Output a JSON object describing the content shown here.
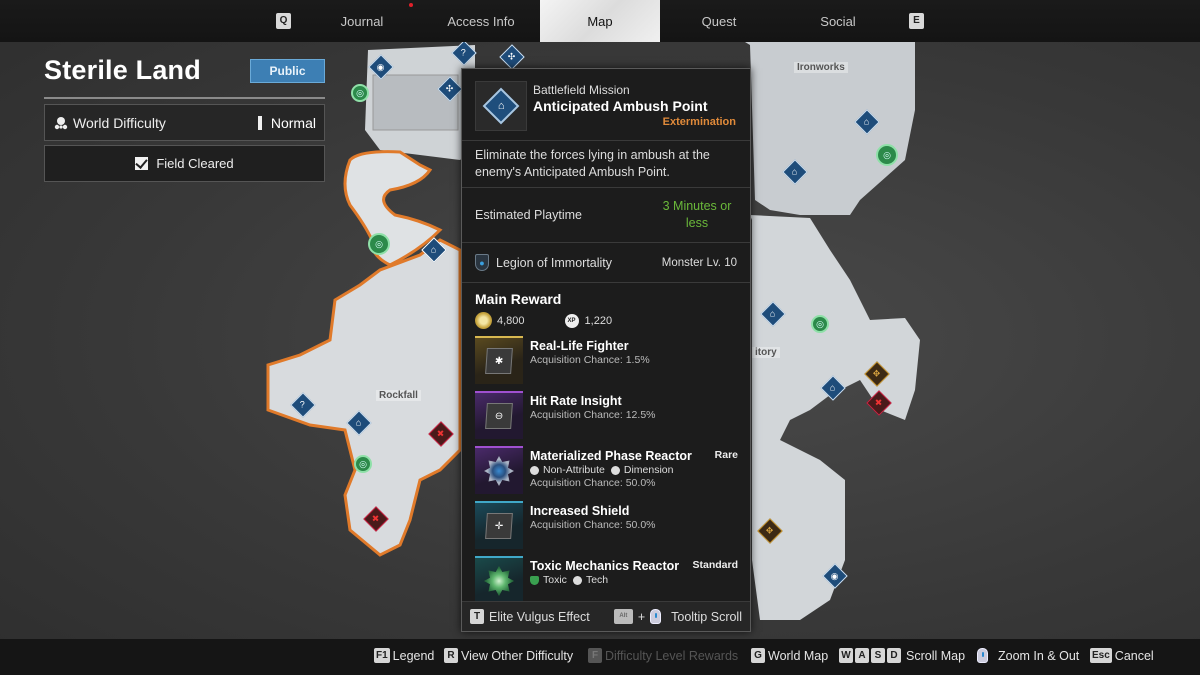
{
  "nav": {
    "prev_key": "Q",
    "next_key": "E",
    "tabs": [
      {
        "label": "Journal",
        "active": false,
        "notification": true
      },
      {
        "label": "Access Info",
        "active": false
      },
      {
        "label": "Map",
        "active": true
      },
      {
        "label": "Quest",
        "active": false
      },
      {
        "label": "Social",
        "active": false
      }
    ]
  },
  "region": {
    "title": "Sterile Land",
    "visibility_button": "Public",
    "difficulty_label": "World Difficulty",
    "difficulty_value": "Normal",
    "field_status": "Field Cleared",
    "field_cleared": true
  },
  "map": {
    "labels": [
      "Ironworks",
      "Rockfall",
      "itory"
    ],
    "accent_orange": "#e07a2a",
    "marker_colors": {
      "mission": "#1e4c7a",
      "outpost": "#2c8a4a",
      "enemy": "#c22244",
      "boss": "#c9962e"
    }
  },
  "tooltip": {
    "icon": "battlefield-mission-icon",
    "category": "Battlefield Mission",
    "name": "Anticipated Ambush Point",
    "type": "Extermination",
    "type_color": "#e08a3a",
    "description": "Eliminate the forces lying in ambush at the enemy's Anticipated Ambush Point.",
    "playtime_label": "Estimated Playtime",
    "playtime_value": "3 Minutes or less",
    "faction": "Legion of Immortality",
    "monster_level": "Monster Lv. 10",
    "reward_title": "Main Reward",
    "gold": "4,800",
    "xp": "1,220",
    "rewards": [
      {
        "name": "Real-Life Fighter",
        "chance": "Acquisition Chance: 1.5%",
        "grade": "",
        "tier": "gold",
        "attrs": []
      },
      {
        "name": "Hit Rate Insight",
        "chance": "Acquisition Chance: 12.5%",
        "grade": "",
        "tier": "purple",
        "attrs": []
      },
      {
        "name": "Materialized Phase Reactor",
        "chance": "Acquisition Chance: 50.0%",
        "grade": "Rare",
        "tier": "purple",
        "attrs": [
          "Non-Attribute",
          "Dimension"
        ]
      },
      {
        "name": "Increased Shield",
        "chance": "Acquisition Chance: 50.0%",
        "grade": "",
        "tier": "teal",
        "attrs": []
      },
      {
        "name": "Toxic Mechanics Reactor",
        "chance": "",
        "grade": "Standard",
        "tier": "teal",
        "attrs": [
          "Toxic",
          "Tech"
        ]
      }
    ],
    "footer": {
      "elite_key": "T",
      "elite_label": "Elite Vulgus Effect",
      "scroll_key": "Alt",
      "scroll_label": "Tooltip Scroll"
    }
  },
  "bottom_hints": [
    {
      "keys": [
        "F1"
      ],
      "label": "Legend",
      "enabled": true
    },
    {
      "keys": [
        "R"
      ],
      "label": "View Other Difficulty",
      "enabled": true
    },
    {
      "keys": [
        "F"
      ],
      "label": "Difficulty Level Rewards",
      "enabled": false
    },
    {
      "keys": [
        "G"
      ],
      "label": "World Map",
      "enabled": true
    },
    {
      "keys": [
        "W",
        "A",
        "S",
        "D"
      ],
      "label": "Scroll Map",
      "enabled": true
    },
    {
      "keys": [
        "mouse-wheel"
      ],
      "label": "Zoom In & Out",
      "enabled": true
    },
    {
      "keys": [
        "Esc"
      ],
      "label": "Cancel",
      "enabled": true
    }
  ]
}
